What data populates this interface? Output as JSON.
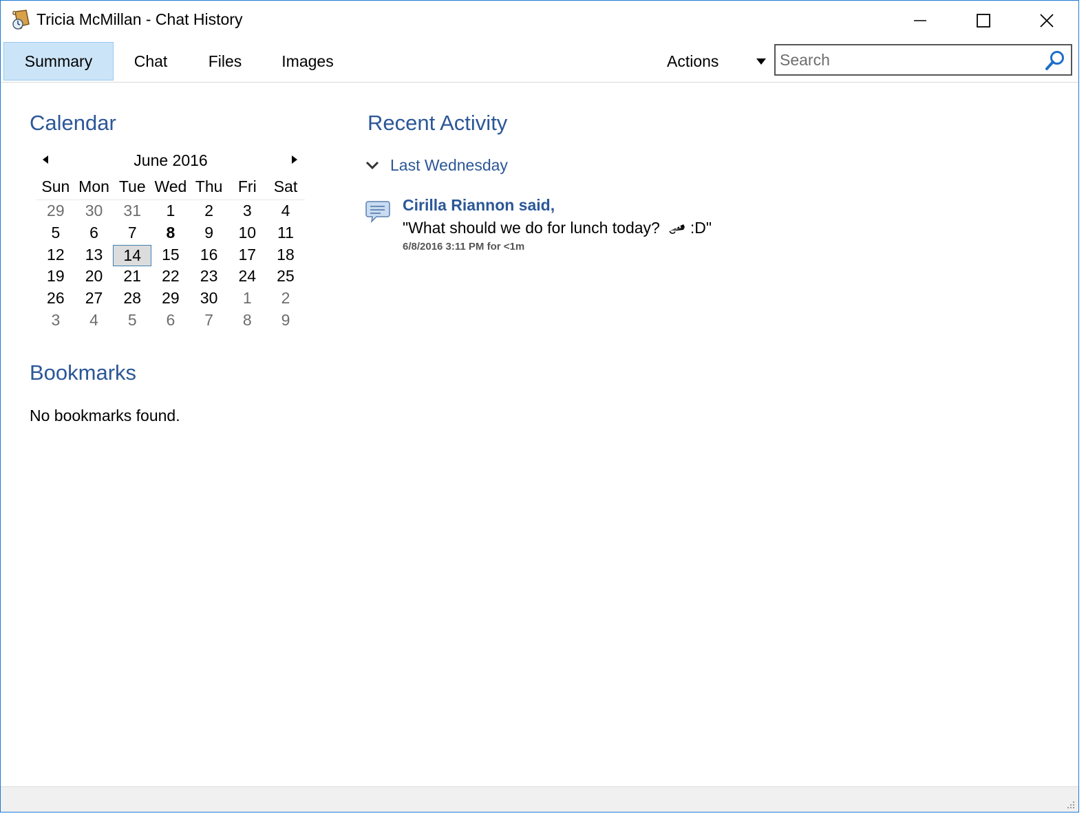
{
  "window": {
    "title": "Tricia McMillan - Chat History",
    "icon": "scroll-icon"
  },
  "tabs": {
    "summary": "Summary",
    "chat": "Chat",
    "files": "Files",
    "images": "Images",
    "active": "Summary"
  },
  "toolbar": {
    "actions_label": "Actions",
    "search_placeholder": "Search"
  },
  "calendar": {
    "title": "Calendar",
    "month": "June 2016",
    "weekdays": [
      "Sun",
      "Mon",
      "Tue",
      "Wed",
      "Thu",
      "Fri",
      "Sat"
    ],
    "weeks": [
      [
        {
          "d": "29",
          "other": true
        },
        {
          "d": "30",
          "other": true
        },
        {
          "d": "31",
          "other": true
        },
        {
          "d": "1"
        },
        {
          "d": "2"
        },
        {
          "d": "3"
        },
        {
          "d": "4"
        }
      ],
      [
        {
          "d": "5"
        },
        {
          "d": "6"
        },
        {
          "d": "7"
        },
        {
          "d": "8",
          "bold": true
        },
        {
          "d": "9"
        },
        {
          "d": "10"
        },
        {
          "d": "11"
        }
      ],
      [
        {
          "d": "12"
        },
        {
          "d": "13"
        },
        {
          "d": "14",
          "today": true
        },
        {
          "d": "15"
        },
        {
          "d": "16"
        },
        {
          "d": "17"
        },
        {
          "d": "18"
        }
      ],
      [
        {
          "d": "19"
        },
        {
          "d": "20"
        },
        {
          "d": "21"
        },
        {
          "d": "22"
        },
        {
          "d": "23"
        },
        {
          "d": "24"
        },
        {
          "d": "25"
        }
      ],
      [
        {
          "d": "26"
        },
        {
          "d": "27"
        },
        {
          "d": "28"
        },
        {
          "d": "29"
        },
        {
          "d": "30"
        },
        {
          "d": "1",
          "other": true
        },
        {
          "d": "2",
          "other": true
        }
      ],
      [
        {
          "d": "3",
          "other": true
        },
        {
          "d": "4",
          "other": true
        },
        {
          "d": "5",
          "other": true
        },
        {
          "d": "6",
          "other": true
        },
        {
          "d": "7",
          "other": true
        },
        {
          "d": "8",
          "other": true
        },
        {
          "d": "9",
          "other": true
        }
      ]
    ]
  },
  "bookmarks": {
    "title": "Bookmarks",
    "empty_text": "No bookmarks found."
  },
  "recent_activity": {
    "title": "Recent Activity",
    "group_label": "Last Wednesday",
    "items": [
      {
        "sender": "Cirilla Riannon said,",
        "message_before": "\"What should we do for lunch today?",
        "message_after": ":D\"",
        "emoticon": "pizza-icon",
        "timestamp": "6/8/2016 3:11 PM for <1m"
      }
    ]
  },
  "colors": {
    "accent": "#2b5797",
    "tab_active_bg": "#cce4f7",
    "window_border": "#1c79d6",
    "statusbar": "#f0f0f0"
  }
}
